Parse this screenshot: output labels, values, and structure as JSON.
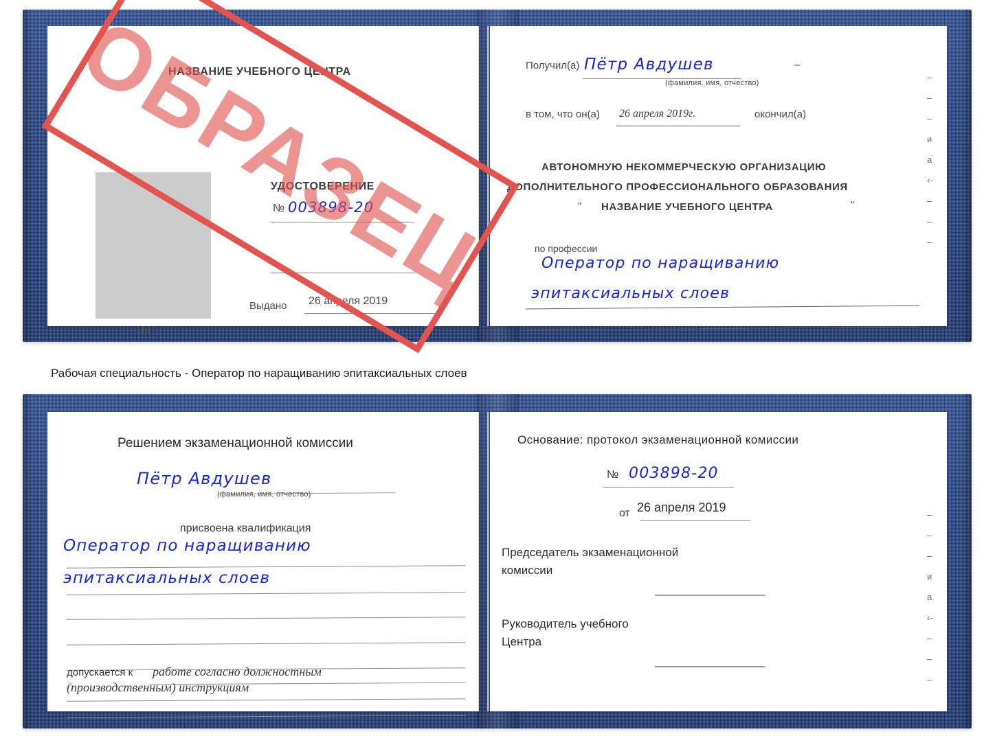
{
  "caption": "Рабочая специальность - Оператор по наращиванию эпитаксиальных слоев",
  "watermark": {
    "text": "ОБРАЗЕЦ",
    "color": "#e2544e"
  },
  "colors": {
    "cover_blue": "#22407f",
    "handwriting_blue": "#1a25d8",
    "photo_gray": "#cccccc"
  },
  "certificate_top": {
    "left_page": {
      "center_name": "НАЗВАНИЕ УЧЕБНОГО ЦЕНТРА",
      "doc_type": "УДОСТОВЕРЕНИЕ",
      "number_symbol": "№",
      "number_value": "003898-20",
      "issued_label": "Выдано",
      "issued_date": "26 апреля 2019",
      "seal_label": "М.П."
    },
    "right_page": {
      "received_label": "Получил(а)",
      "received_name": "Пётр Авдушев",
      "fio_hint": "(фамилия, имя, отчество)",
      "that_label": "в том, что он(а)",
      "completion_date": "26 апреля 2019г.",
      "finished_label": "окончил(а)",
      "org_line1": "АВТОНОМНУЮ НЕКОММЕРЧЕСКУЮ ОРГАНИЗАЦИЮ",
      "org_line2": "ДОПОЛНИТЕЛЬНОГО ПРОФЕССИОНАЛЬНОГО ОБРАЗОВАНИЯ",
      "org_quote_open": "\"",
      "org_line3": "НАЗВАНИЕ УЧЕБНОГО ЦЕНТРА",
      "org_quote_close": "\"",
      "profession_label": "по профессии",
      "profession_line1": "Оператор по наращиванию",
      "profession_line2": "эпитаксиальных слоев",
      "edge_fragments": [
        "–",
        "–",
        "–",
        "и",
        "а",
        "‹-",
        "–",
        "–",
        "–"
      ]
    }
  },
  "certificate_bottom": {
    "left_page": {
      "decision_title": "Решением экзаменационной комиссии",
      "name": "Пётр Авдушев",
      "fio_hint": "(фамилия, имя, отчество)",
      "qualification_label": "присвоена квалификация",
      "qualification_line1": "Оператор по наращиванию",
      "qualification_line2": "эпитаксиальных слоев",
      "admitted_label": "допускается к",
      "admitted_line1": "работе согласно должностным",
      "admitted_line2": "(производственным) инструкциям"
    },
    "right_page": {
      "basis_label": "Основание: протокол экзаменационной комиссии",
      "number_symbol": "№",
      "number_value": "003898-20",
      "from_label": "от",
      "from_date": "26 апреля 2019",
      "chairman_line1": "Председатель экзаменационной",
      "chairman_line2": "комиссии",
      "head_line1": "Руководитель учебного",
      "head_line2": "Центра",
      "edge_fragments": [
        "–",
        "–",
        "–",
        "и",
        "а",
        "‹-",
        "–",
        "–",
        "–"
      ]
    }
  }
}
